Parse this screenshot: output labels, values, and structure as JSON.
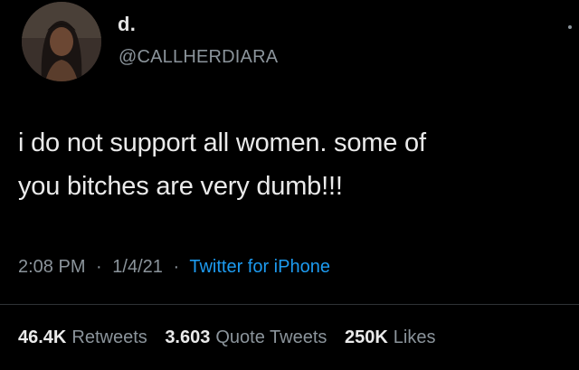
{
  "author": {
    "display_name": "d.",
    "handle": "@CALLHERDIARA"
  },
  "tweet": {
    "text_lines": [
      "i do not support all women. some of",
      "you bitches are very dumb!!!"
    ]
  },
  "meta": {
    "time": "2:08 PM",
    "date": "1/4/21",
    "separator": "·",
    "source": "Twitter for iPhone"
  },
  "stats": {
    "retweets_count": "46.4K",
    "retweets_label": "Retweets",
    "quotes_count": "3.603",
    "quotes_label": "Quote Tweets",
    "likes_count": "250K",
    "likes_label": "Likes"
  },
  "colors": {
    "background": "#000000",
    "text": "#eaeaea",
    "secondary": "#8b949b",
    "link": "#1d9bf0"
  }
}
